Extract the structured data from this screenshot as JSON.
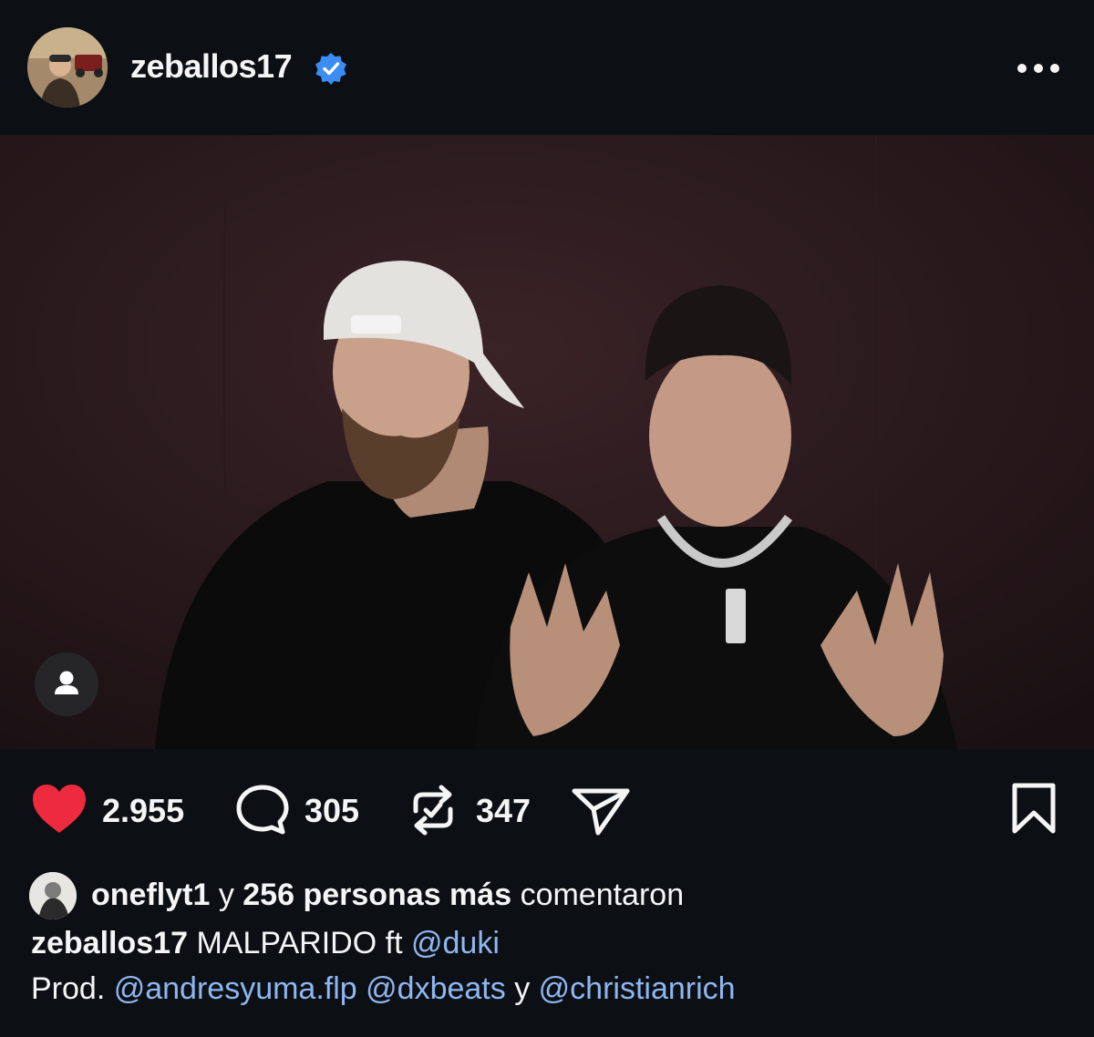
{
  "header": {
    "username": "zeballos17",
    "verified_icon": "verified-badge-icon",
    "more_icon": "more-options-icon"
  },
  "actions": {
    "likes": "2.955",
    "comments": "305",
    "reposts": "347",
    "liked": true,
    "like_color": "#ee2a3e"
  },
  "social": {
    "user": "oneflyt1",
    "connector": "y",
    "others": "256 personas más",
    "verb": "comentaron"
  },
  "caption": {
    "author": "zeballos17",
    "text": "MALPARIDO ft",
    "mention1": "@duki",
    "prod_label": "Prod.",
    "mention2": "@andresyuma.flp",
    "mention3": "@dxbeats",
    "and": "y",
    "mention4": "@christianrich"
  },
  "colors": {
    "background": "#0c1014",
    "link": "#8fb6f0",
    "verified": "#3b8cf3"
  }
}
